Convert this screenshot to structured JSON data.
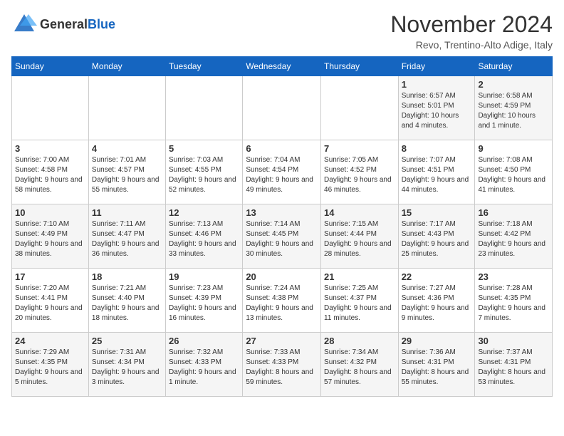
{
  "header": {
    "logo_general": "General",
    "logo_blue": "Blue",
    "title": "November 2024",
    "location": "Revo, Trentino-Alto Adige, Italy"
  },
  "days_of_week": [
    "Sunday",
    "Monday",
    "Tuesday",
    "Wednesday",
    "Thursday",
    "Friday",
    "Saturday"
  ],
  "weeks": [
    [
      {
        "day": "",
        "info": ""
      },
      {
        "day": "",
        "info": ""
      },
      {
        "day": "",
        "info": ""
      },
      {
        "day": "",
        "info": ""
      },
      {
        "day": "",
        "info": ""
      },
      {
        "day": "1",
        "info": "Sunrise: 6:57 AM\nSunset: 5:01 PM\nDaylight: 10 hours and 4 minutes."
      },
      {
        "day": "2",
        "info": "Sunrise: 6:58 AM\nSunset: 4:59 PM\nDaylight: 10 hours and 1 minute."
      }
    ],
    [
      {
        "day": "3",
        "info": "Sunrise: 7:00 AM\nSunset: 4:58 PM\nDaylight: 9 hours and 58 minutes."
      },
      {
        "day": "4",
        "info": "Sunrise: 7:01 AM\nSunset: 4:57 PM\nDaylight: 9 hours and 55 minutes."
      },
      {
        "day": "5",
        "info": "Sunrise: 7:03 AM\nSunset: 4:55 PM\nDaylight: 9 hours and 52 minutes."
      },
      {
        "day": "6",
        "info": "Sunrise: 7:04 AM\nSunset: 4:54 PM\nDaylight: 9 hours and 49 minutes."
      },
      {
        "day": "7",
        "info": "Sunrise: 7:05 AM\nSunset: 4:52 PM\nDaylight: 9 hours and 46 minutes."
      },
      {
        "day": "8",
        "info": "Sunrise: 7:07 AM\nSunset: 4:51 PM\nDaylight: 9 hours and 44 minutes."
      },
      {
        "day": "9",
        "info": "Sunrise: 7:08 AM\nSunset: 4:50 PM\nDaylight: 9 hours and 41 minutes."
      }
    ],
    [
      {
        "day": "10",
        "info": "Sunrise: 7:10 AM\nSunset: 4:49 PM\nDaylight: 9 hours and 38 minutes."
      },
      {
        "day": "11",
        "info": "Sunrise: 7:11 AM\nSunset: 4:47 PM\nDaylight: 9 hours and 36 minutes."
      },
      {
        "day": "12",
        "info": "Sunrise: 7:13 AM\nSunset: 4:46 PM\nDaylight: 9 hours and 33 minutes."
      },
      {
        "day": "13",
        "info": "Sunrise: 7:14 AM\nSunset: 4:45 PM\nDaylight: 9 hours and 30 minutes."
      },
      {
        "day": "14",
        "info": "Sunrise: 7:15 AM\nSunset: 4:44 PM\nDaylight: 9 hours and 28 minutes."
      },
      {
        "day": "15",
        "info": "Sunrise: 7:17 AM\nSunset: 4:43 PM\nDaylight: 9 hours and 25 minutes."
      },
      {
        "day": "16",
        "info": "Sunrise: 7:18 AM\nSunset: 4:42 PM\nDaylight: 9 hours and 23 minutes."
      }
    ],
    [
      {
        "day": "17",
        "info": "Sunrise: 7:20 AM\nSunset: 4:41 PM\nDaylight: 9 hours and 20 minutes."
      },
      {
        "day": "18",
        "info": "Sunrise: 7:21 AM\nSunset: 4:40 PM\nDaylight: 9 hours and 18 minutes."
      },
      {
        "day": "19",
        "info": "Sunrise: 7:23 AM\nSunset: 4:39 PM\nDaylight: 9 hours and 16 minutes."
      },
      {
        "day": "20",
        "info": "Sunrise: 7:24 AM\nSunset: 4:38 PM\nDaylight: 9 hours and 13 minutes."
      },
      {
        "day": "21",
        "info": "Sunrise: 7:25 AM\nSunset: 4:37 PM\nDaylight: 9 hours and 11 minutes."
      },
      {
        "day": "22",
        "info": "Sunrise: 7:27 AM\nSunset: 4:36 PM\nDaylight: 9 hours and 9 minutes."
      },
      {
        "day": "23",
        "info": "Sunrise: 7:28 AM\nSunset: 4:35 PM\nDaylight: 9 hours and 7 minutes."
      }
    ],
    [
      {
        "day": "24",
        "info": "Sunrise: 7:29 AM\nSunset: 4:35 PM\nDaylight: 9 hours and 5 minutes."
      },
      {
        "day": "25",
        "info": "Sunrise: 7:31 AM\nSunset: 4:34 PM\nDaylight: 9 hours and 3 minutes."
      },
      {
        "day": "26",
        "info": "Sunrise: 7:32 AM\nSunset: 4:33 PM\nDaylight: 9 hours and 1 minute."
      },
      {
        "day": "27",
        "info": "Sunrise: 7:33 AM\nSunset: 4:33 PM\nDaylight: 8 hours and 59 minutes."
      },
      {
        "day": "28",
        "info": "Sunrise: 7:34 AM\nSunset: 4:32 PM\nDaylight: 8 hours and 57 minutes."
      },
      {
        "day": "29",
        "info": "Sunrise: 7:36 AM\nSunset: 4:31 PM\nDaylight: 8 hours and 55 minutes."
      },
      {
        "day": "30",
        "info": "Sunrise: 7:37 AM\nSunset: 4:31 PM\nDaylight: 8 hours and 53 minutes."
      }
    ]
  ]
}
